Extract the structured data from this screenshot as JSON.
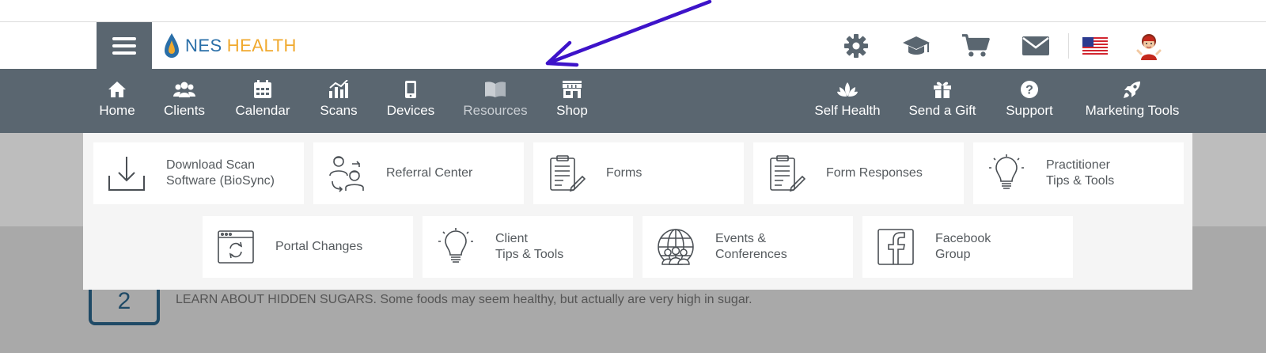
{
  "brand": {
    "name_part1": "NES",
    "name_part2": "HEALTH"
  },
  "header_icons": [
    {
      "name": "settings-gear-icon"
    },
    {
      "name": "graduation-cap-icon"
    },
    {
      "name": "shopping-cart-icon"
    },
    {
      "name": "mail-icon"
    },
    {
      "name": "us-flag-icon"
    },
    {
      "name": "user-avatar"
    }
  ],
  "nav": {
    "items": [
      {
        "label": "Home",
        "icon": "home-icon"
      },
      {
        "label": "Clients",
        "icon": "clients-icon"
      },
      {
        "label": "Calendar",
        "icon": "calendar-icon"
      },
      {
        "label": "Scans",
        "icon": "bar-chart-icon"
      },
      {
        "label": "Devices",
        "icon": "mobile-device-icon"
      },
      {
        "label": "Resources",
        "icon": "book-icon",
        "active": true
      },
      {
        "label": "Shop",
        "icon": "storefront-icon"
      },
      {
        "label": "Self Health",
        "icon": "lotus-icon"
      },
      {
        "label": "Send a Gift",
        "icon": "gift-icon"
      },
      {
        "label": "Support",
        "icon": "help-icon"
      },
      {
        "label": "Marketing Tools",
        "icon": "rocket-icon"
      }
    ]
  },
  "resources_menu": {
    "row1": [
      {
        "line1": "Download Scan",
        "line2": "Software (BioSync)",
        "icon": "download-icon"
      },
      {
        "line1": "Referral Center",
        "line2": "",
        "icon": "referral-people-icon"
      },
      {
        "line1": "Forms",
        "line2": "",
        "icon": "clipboard-form-icon"
      },
      {
        "line1": "Form Responses",
        "line2": "",
        "icon": "clipboard-edit-icon"
      },
      {
        "line1": "Practitioner",
        "line2": "Tips & Tools",
        "icon": "lightbulb-icon"
      }
    ],
    "row2": [
      {
        "line1": "Portal Changes",
        "line2": "",
        "icon": "browser-refresh-icon"
      },
      {
        "line1": "Client",
        "line2": "Tips & Tools",
        "icon": "lightbulb-icon"
      },
      {
        "line1": "Events &",
        "line2": "Conferences",
        "icon": "globe-people-icon"
      },
      {
        "line1": "Facebook",
        "line2": "Group",
        "icon": "facebook-icon"
      }
    ]
  },
  "background_content": {
    "step_number": "2",
    "text": "LEARN ABOUT HIDDEN SUGARS. Some foods may seem healthy, but actually are very high in sugar."
  },
  "colors": {
    "nav_bg": "#5a6670",
    "arrow": "#3d13c9",
    "logo_blue": "#2a6fa8",
    "logo_orange": "#f0a92e"
  }
}
